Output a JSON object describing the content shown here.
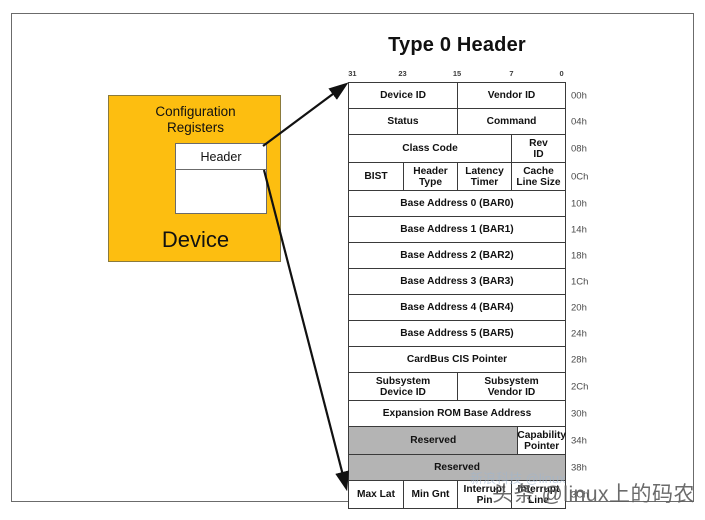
{
  "title": "Type 0 Header",
  "device": {
    "config_registers_label": "Configuration\nRegisters",
    "config_line1": "Configuration",
    "config_line2": "Registers",
    "header_label": "Header",
    "device_label": "Device"
  },
  "bit_ruler": {
    "labels": [
      "31",
      "23",
      "15",
      "7",
      "0"
    ],
    "positions_pct": [
      2,
      25,
      50,
      75,
      98
    ]
  },
  "register_table": {
    "rows": [
      {
        "offset": "00h",
        "cells": [
          {
            "label": "Device ID",
            "width": "w50"
          },
          {
            "label": "Vendor ID",
            "width": "w50"
          }
        ]
      },
      {
        "offset": "04h",
        "cells": [
          {
            "label": "Status",
            "width": "w50"
          },
          {
            "label": "Command",
            "width": "w50"
          }
        ]
      },
      {
        "offset": "08h",
        "cells": [
          {
            "label": "Class Code",
            "width": "w75"
          },
          {
            "label": "Rev\nID",
            "width": "w25"
          }
        ]
      },
      {
        "offset": "0Ch",
        "cells": [
          {
            "label": "BIST",
            "width": "w25"
          },
          {
            "label": "Header\nType",
            "width": "w25"
          },
          {
            "label": "Latency\nTimer",
            "width": "w25"
          },
          {
            "label": "Cache\nLine Size",
            "width": "w25"
          }
        ]
      },
      {
        "offset": "10h",
        "cells": [
          {
            "label": "Base Address 0 (BAR0)",
            "width": "w100"
          }
        ]
      },
      {
        "offset": "14h",
        "cells": [
          {
            "label": "Base Address 1 (BAR1)",
            "width": "w100"
          }
        ]
      },
      {
        "offset": "18h",
        "cells": [
          {
            "label": "Base Address 2 (BAR2)",
            "width": "w100"
          }
        ]
      },
      {
        "offset": "1Ch",
        "cells": [
          {
            "label": "Base Address 3 (BAR3)",
            "width": "w100"
          }
        ]
      },
      {
        "offset": "20h",
        "cells": [
          {
            "label": "Base Address 4 (BAR4)",
            "width": "w100"
          }
        ]
      },
      {
        "offset": "24h",
        "cells": [
          {
            "label": "Base Address 5 (BAR5)",
            "width": "w100"
          }
        ]
      },
      {
        "offset": "28h",
        "cells": [
          {
            "label": "CardBus CIS Pointer",
            "width": "w100"
          }
        ]
      },
      {
        "offset": "2Ch",
        "cells": [
          {
            "label": "Subsystem\nDevice ID",
            "width": "w50"
          },
          {
            "label": "Subsystem\nVendor ID",
            "width": "w50"
          }
        ]
      },
      {
        "offset": "30h",
        "cells": [
          {
            "label": "Expansion ROM Base Address",
            "width": "w100"
          }
        ]
      },
      {
        "offset": "34h",
        "cells": [
          {
            "label": "Reserved",
            "width": "w78",
            "shaded": true
          },
          {
            "label": "Capability\nPointer",
            "width": "w22"
          }
        ]
      },
      {
        "offset": "38h",
        "cells": [
          {
            "label": "Reserved",
            "width": "w100",
            "shaded": true
          }
        ]
      },
      {
        "offset": "3Ch",
        "cells": [
          {
            "label": "Max Lat",
            "width": "w25"
          },
          {
            "label": "Min Gnt",
            "width": "w25"
          },
          {
            "label": "Interrupt\nPin",
            "width": "w25"
          },
          {
            "label": "Interrupt\nLine",
            "width": "w25"
          }
        ]
      }
    ]
  },
  "watermark": {
    "text": "头条 @linux上的码农",
    "faint_text": "新浪科技 @linux"
  },
  "colors": {
    "device_orange": "#FDBE10",
    "reserved_gray": "#B4B4B4",
    "border": "#3A3A3A",
    "frame": "#6B6B6B"
  }
}
